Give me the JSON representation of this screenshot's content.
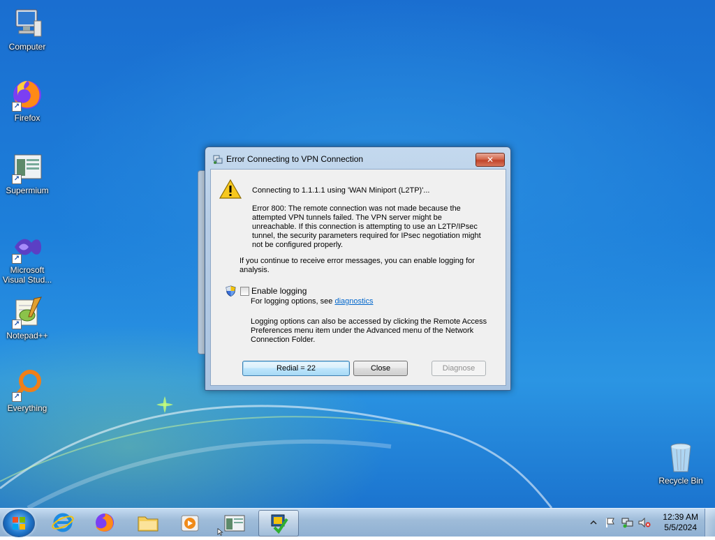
{
  "desktop_icons": [
    {
      "label": "Computer",
      "icon": "computer-icon"
    },
    {
      "label": "Firefox",
      "icon": "firefox-icon"
    },
    {
      "label": "Supermium",
      "icon": "supermium-icon"
    },
    {
      "label": "Microsoft Visual Stud...",
      "icon": "visual-studio-icon"
    },
    {
      "label": "Notepad++",
      "icon": "notepadpp-icon"
    },
    {
      "label": "Everything",
      "icon": "everything-icon"
    },
    {
      "label": "Recycle Bin",
      "icon": "recycle-bin-icon"
    }
  ],
  "dialog": {
    "title": "Error Connecting to VPN Connection",
    "close_label": "✕",
    "connecting_text": "Connecting to 1.1.1.1 using 'WAN Miniport (L2TP)'...",
    "error_lines": [
      "Error 800: The remote connection was not made because the",
      "attempted VPN tunnels failed. The VPN server might be",
      "unreachable. If this connection is attempting to use an L2TP/IPsec",
      "tunnel, the security parameters required for IPsec negotiation might",
      "not be configured properly."
    ],
    "continue_lines": [
      "If you continue to receive error messages, you can enable logging for",
      "analysis."
    ],
    "enable_logging_label": "Enable logging",
    "logging_options_prefix": "For logging options, see ",
    "diagnostics_link": "diagnostics",
    "info_lines": [
      "Logging options can also be accessed by clicking the Remote Access",
      "Preferences menu item under the Advanced menu of the Network",
      "Connection Folder."
    ],
    "redial_label": "Redial = 22",
    "close_button_label": "Close",
    "diagnose_label": "Diagnose"
  },
  "taskbar": {
    "clock_time": "12:39 AM",
    "clock_date": "5/5/2024",
    "pinned": [
      "internet-explorer-icon",
      "firefox-icon",
      "file-explorer-icon",
      "media-player-icon",
      "supermium-icon",
      "vpn-connection-icon"
    ]
  }
}
